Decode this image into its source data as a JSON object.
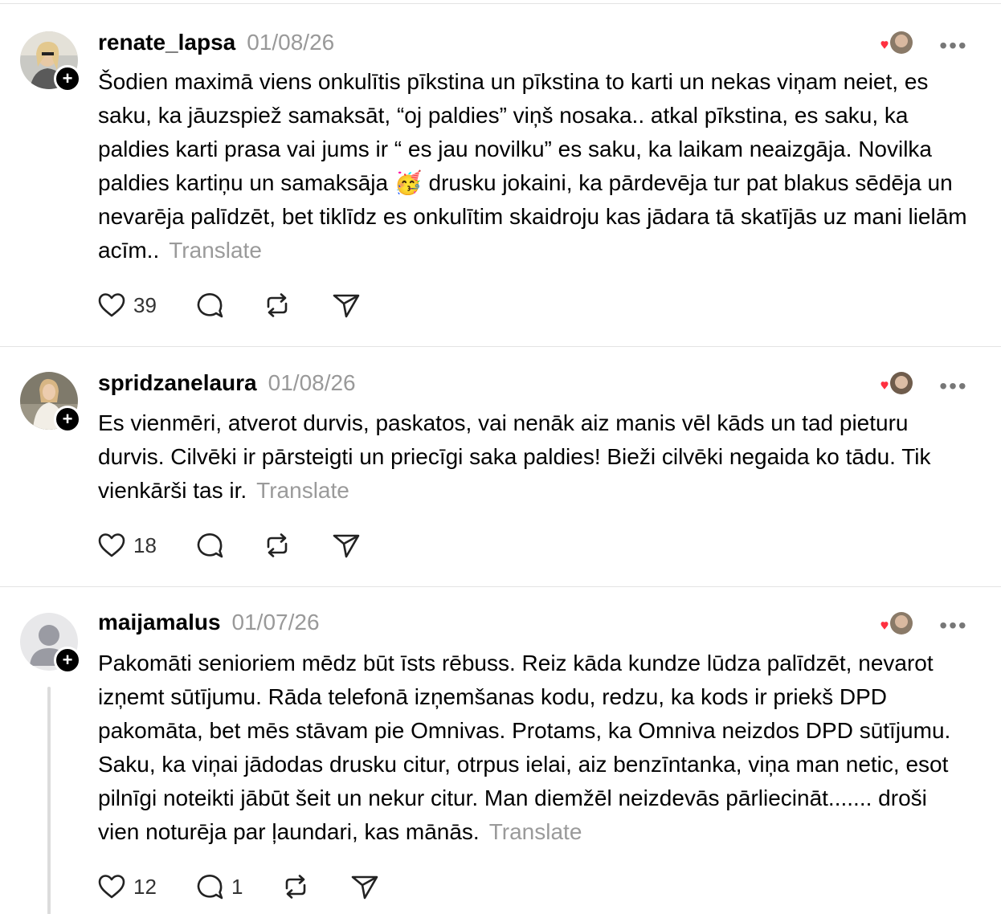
{
  "posts": [
    {
      "username": "renate_lapsa",
      "date": "01/08/26",
      "text": "Šodien maximā viens onkulītis pīkstina un pīkstina to karti un nekas viņam neiet, es saku, ka jāuzspiež samaksāt, “oj paldies” viņš nosaka.. atkal pīkstina, es saku, ka paldies karti prasa vai jums ir “ es jau novilku” es saku, ka laikam neaizgāja. Novilka paldies kartiņu un samaksāja 🥳 drusku jokaini, ka pārdevēja tur pat blakus sēdēja un nevarēja palīdzēt, bet tiklīdz es onkulītim skaidroju kas jādara tā skatījās uz mani lielām acīm..",
      "translate_label": "Translate",
      "likes": "39",
      "replies": "",
      "icons": [
        "heart-icon",
        "comment-icon",
        "repost-icon",
        "share-icon"
      ]
    },
    {
      "username": "spridzanelaura",
      "date": "01/08/26",
      "text": "Es vienmēri, atverot durvis, paskatos, vai nenāk aiz manis vēl kāds un tad pieturu durvis. Cilvēki ir pārsteigti un priecīgi saka paldies! Bieži cilvēki negaida ko tādu. Tik vienkārši tas ir.",
      "translate_label": "Translate",
      "likes": "18",
      "replies": "",
      "icons": [
        "heart-icon",
        "comment-icon",
        "repost-icon",
        "share-icon"
      ]
    },
    {
      "username": "maijamalus",
      "date": "01/07/26",
      "text": "Pakomāti senioriem mēdz būt īsts rēbuss. Reiz kāda kundze lūdza palīdzēt, nevarot izņemt sūtījumu. Rāda telefonā izņemšanas kodu, redzu, ka kods ir priekš DPD pakomāta, bet mēs stāvam pie Omnivas. Protams, ka Omniva neizdos DPD sūtījumu. Saku, ka viņai jādodas drusku citur, otrpus ielai, aiz benzīntanka, viņa man netic, esot pilnīgi noteikti jābūt šeit un nekur citur. Man diemžēl neizdevās pārliecināt....... droši vien noturēja par ļaundari, kas mānās.",
      "translate_label": "Translate",
      "likes": "12",
      "replies": "1",
      "icons": [
        "heart-icon",
        "comment-icon",
        "repost-icon",
        "share-icon"
      ]
    }
  ],
  "more_label": "•••",
  "colors": {
    "heart": "#ff3040",
    "muted": "#999999",
    "divider": "#e3e3e3"
  }
}
